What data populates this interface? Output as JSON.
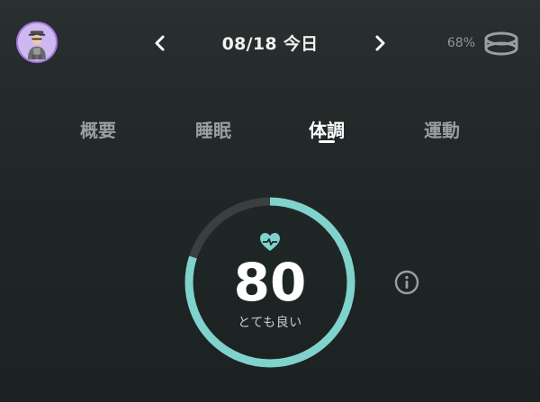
{
  "header": {
    "date": "08/18 今日",
    "battery_percent": "68%",
    "icons": {
      "avatar": "user-avatar",
      "prev": "chevron-left-icon",
      "next": "chevron-right-icon",
      "ring": "smart-ring-icon"
    }
  },
  "tabs": [
    {
      "label": "概要",
      "active": false
    },
    {
      "label": "睡眠",
      "active": false
    },
    {
      "label": "体調",
      "active": true
    },
    {
      "label": "運動",
      "active": false
    }
  ],
  "condition": {
    "score": "80",
    "status": "とても良い",
    "score_fraction": 0.8,
    "icon": "heart-pulse-icon",
    "info_icon": "info-icon"
  },
  "colors": {
    "accent": "#7fd3cc",
    "track": "#3a4040",
    "avatar_border": "#a678e0"
  }
}
